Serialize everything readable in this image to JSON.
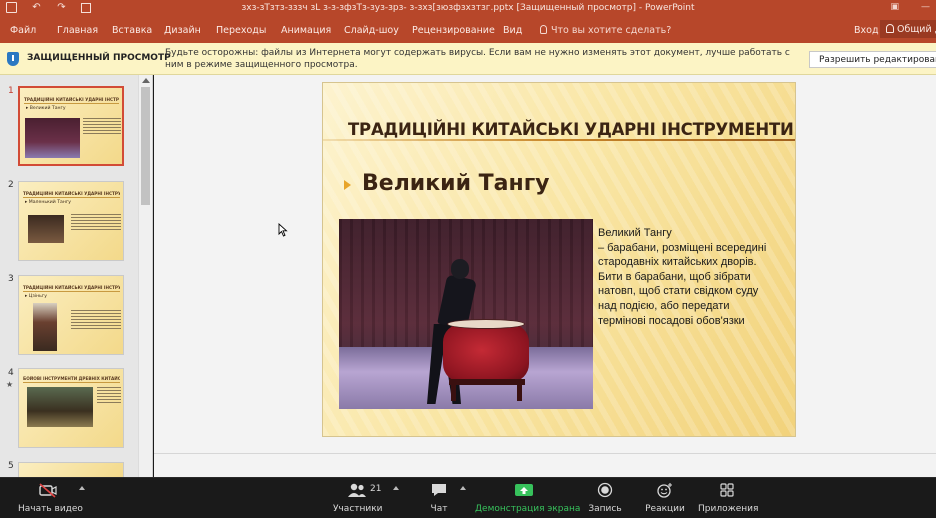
{
  "window": {
    "title": "зхз-зТзтз-зззч зL з-з-зфзТз-зуз-зрз- з-зхз[зюзфзхзтзг.pptx [Защищенный просмотр] - PowerPoint"
  },
  "ribbon": {
    "tabs": [
      "Файл",
      "Главная",
      "Вставка",
      "Дизайн",
      "Переходы",
      "Анимация",
      "Слайд-шоу",
      "Рецензирование",
      "Вид"
    ],
    "tell_me": "Что вы хотите сделать?",
    "sign_in": "Вход",
    "share": "Общий д"
  },
  "protected_view": {
    "title": "ЗАЩИЩЕННЫЙ ПРОСМОТР",
    "message": "Будьте осторожны: файлы из Интернета могут содержать вирусы. Если вам не нужно изменять этот документ, лучше работать с ним в режиме защищенного просмотра.",
    "enable_button": "Разрешить редактирование"
  },
  "thumbnails": [
    {
      "num": "1",
      "title": "ТРАДИЦІЙНІ КИТАЙСЬКІ УДАРНІ ІНСТРУМЕНТИ",
      "subtitle": "Великий Тангу"
    },
    {
      "num": "2",
      "title": "ТРАДИЦІЙНІ КИТАЙСЬКІ УДАРНІ ІНСТРУМЕНТИ",
      "subtitle": "Маленький Тангу"
    },
    {
      "num": "3",
      "title": "ТРАДИЦІЙНІ КИТАЙСЬКІ УДАРНІ ІНСТРУМЕНТИ",
      "subtitle": "Цзіньгу"
    },
    {
      "num": "4",
      "title": "БОЙОВІ ІНСТРУМЕНТИ ДРЕВНІХ КИТАЙСЬКИХ ВОЇНІВ",
      "subtitle": ""
    },
    {
      "num": "5",
      "title": "",
      "subtitle": ""
    }
  ],
  "slide": {
    "title": "ТРАДИЦІЙНІ КИТАЙСЬКІ УДАРНІ ІНСТРУМЕНТИ",
    "subtitle": "Великий Тангу",
    "body_lines": [
      "Великий Тангу",
      "– барабани, розміщені всередині",
      "стародавніх китайських дворів.",
      "Бити в барабани, щоб зібрати",
      "натовп, щоб стати свідком суду",
      "над подією, або передати",
      "термінові посадові обов'язки"
    ]
  },
  "zoom": {
    "start_video": "Начать видео",
    "participants": "Участники",
    "participants_count": "21",
    "chat": "Чат",
    "share_screen": "Демонстрация экрана",
    "record": "Запись",
    "reactions": "Реакции",
    "apps": "Приложения"
  },
  "colors": {
    "ribbon": "#b7472a",
    "protected_bar": "#fcf4c5",
    "share_green": "#37c25c"
  }
}
